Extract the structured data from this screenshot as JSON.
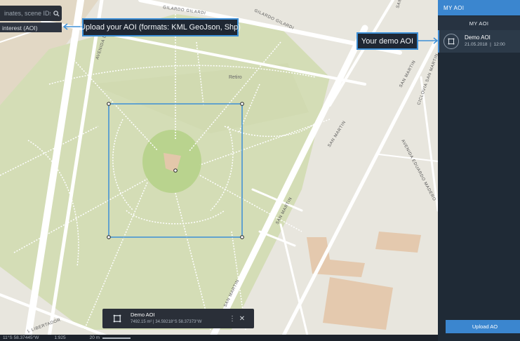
{
  "map": {
    "street_labels": [
      "GILARDO GILARDI",
      "GILARDO GILARDI",
      "AVENIDA DOC",
      "SAN MARTIN",
      "SAN MARTIN",
      "SAN MARTIN",
      "SAN MARTIN",
      "AVENIDA EDUARDO MADERO",
      "CICLOVIA SAN MARTIN",
      "SAN MARTIN",
      "L LIBERTADOR"
    ],
    "place_label": "Retiro",
    "colors": {
      "road": "#ffffff",
      "land": "#e8e6de",
      "park": "#d2dcb2",
      "aoi_outline": "#3d8fd6",
      "building": "#e4c9ae"
    }
  },
  "search": {
    "placeholder": "inates, scene IDs",
    "icon": "search-icon"
  },
  "aoi_chip": {
    "label": "interest (AOI)"
  },
  "callouts": {
    "upload": "Upload your AOI (formats: KML GeoJson, Shp)",
    "demo": "Your demo AOI"
  },
  "panel": {
    "header": "MY AOI",
    "tab": "MY AOI",
    "item": {
      "name": "Demo AOI",
      "date": "21.05.2018",
      "separator": "|",
      "time": "12:00",
      "icon": "polygon-icon"
    },
    "upload_button": "Upload AO"
  },
  "bottom_card": {
    "name": "Demo AOI",
    "meta": "7492.15 m²  |  34.59218°S 58.37373°W",
    "icon": "polygon-icon"
  },
  "statusbar": {
    "coords": "11°S 58.37445°W",
    "scale_ratio": "1:925",
    "scale_len": "20 m"
  }
}
